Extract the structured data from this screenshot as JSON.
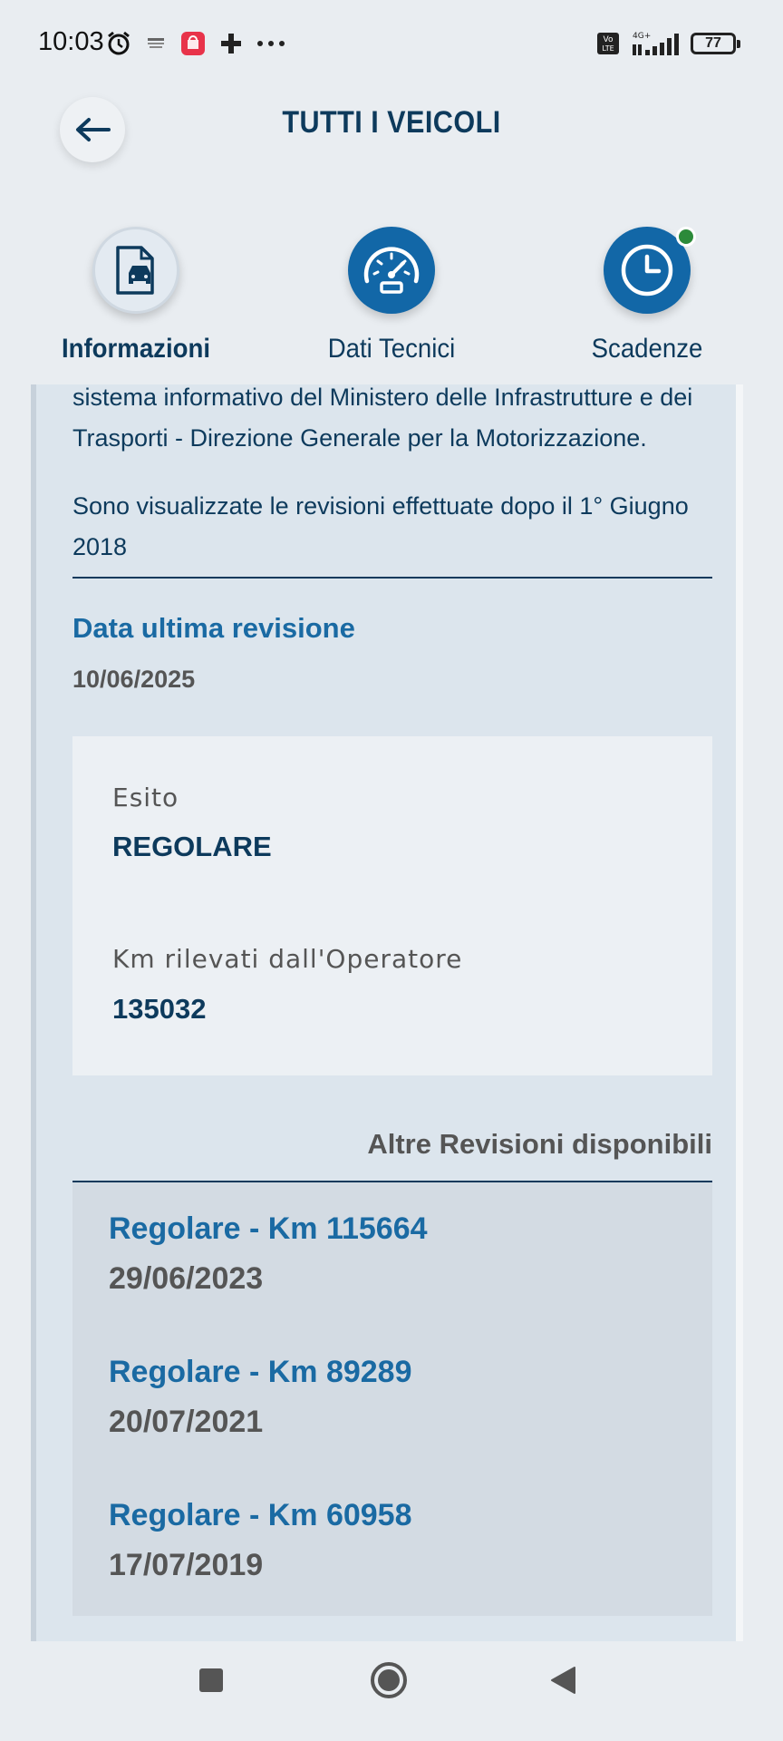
{
  "status_bar": {
    "time": "10:03",
    "battery": "77",
    "network": "4G+",
    "volte": "Vo LTE"
  },
  "header": {
    "title": "TUTTI I VEICOLI"
  },
  "tabs": [
    {
      "label": "Informazioni",
      "icon": "car-document-icon",
      "active": true
    },
    {
      "label": "Dati Tecnici",
      "icon": "speedometer-icon",
      "active": false
    },
    {
      "label": "Scadenze",
      "icon": "clock-icon",
      "active": false,
      "notification": true
    }
  ],
  "intro": {
    "line1": "sistema informativo del Ministero delle Infrastrutture e dei",
    "line2": "Trasporti - Direzione Generale per la Motorizzazione.",
    "line3": "Sono visualizzate le revisioni effettuate dopo il 1° Giugno",
    "line4": "2018"
  },
  "last_revision": {
    "title": "Data ultima revisione",
    "date": "10/06/2025",
    "esito_label": "Esito",
    "esito_value": "REGOLARE",
    "km_label": "Km rilevati dall'Operatore",
    "km_value": "135032"
  },
  "other_revisions": {
    "title": "Altre Revisioni disponibili",
    "items": [
      {
        "title": "Regolare - Km 115664",
        "date": "29/06/2023"
      },
      {
        "title": "Regolare - Km 89289",
        "date": "20/07/2021"
      },
      {
        "title": "Regolare - Km 60958",
        "date": "17/07/2019"
      }
    ]
  },
  "colors": {
    "primary_dark": "#0d3a5c",
    "accent_blue": "#1a6aa3",
    "tab_blue": "#1267a7",
    "notification_green": "#2c8a3a"
  }
}
